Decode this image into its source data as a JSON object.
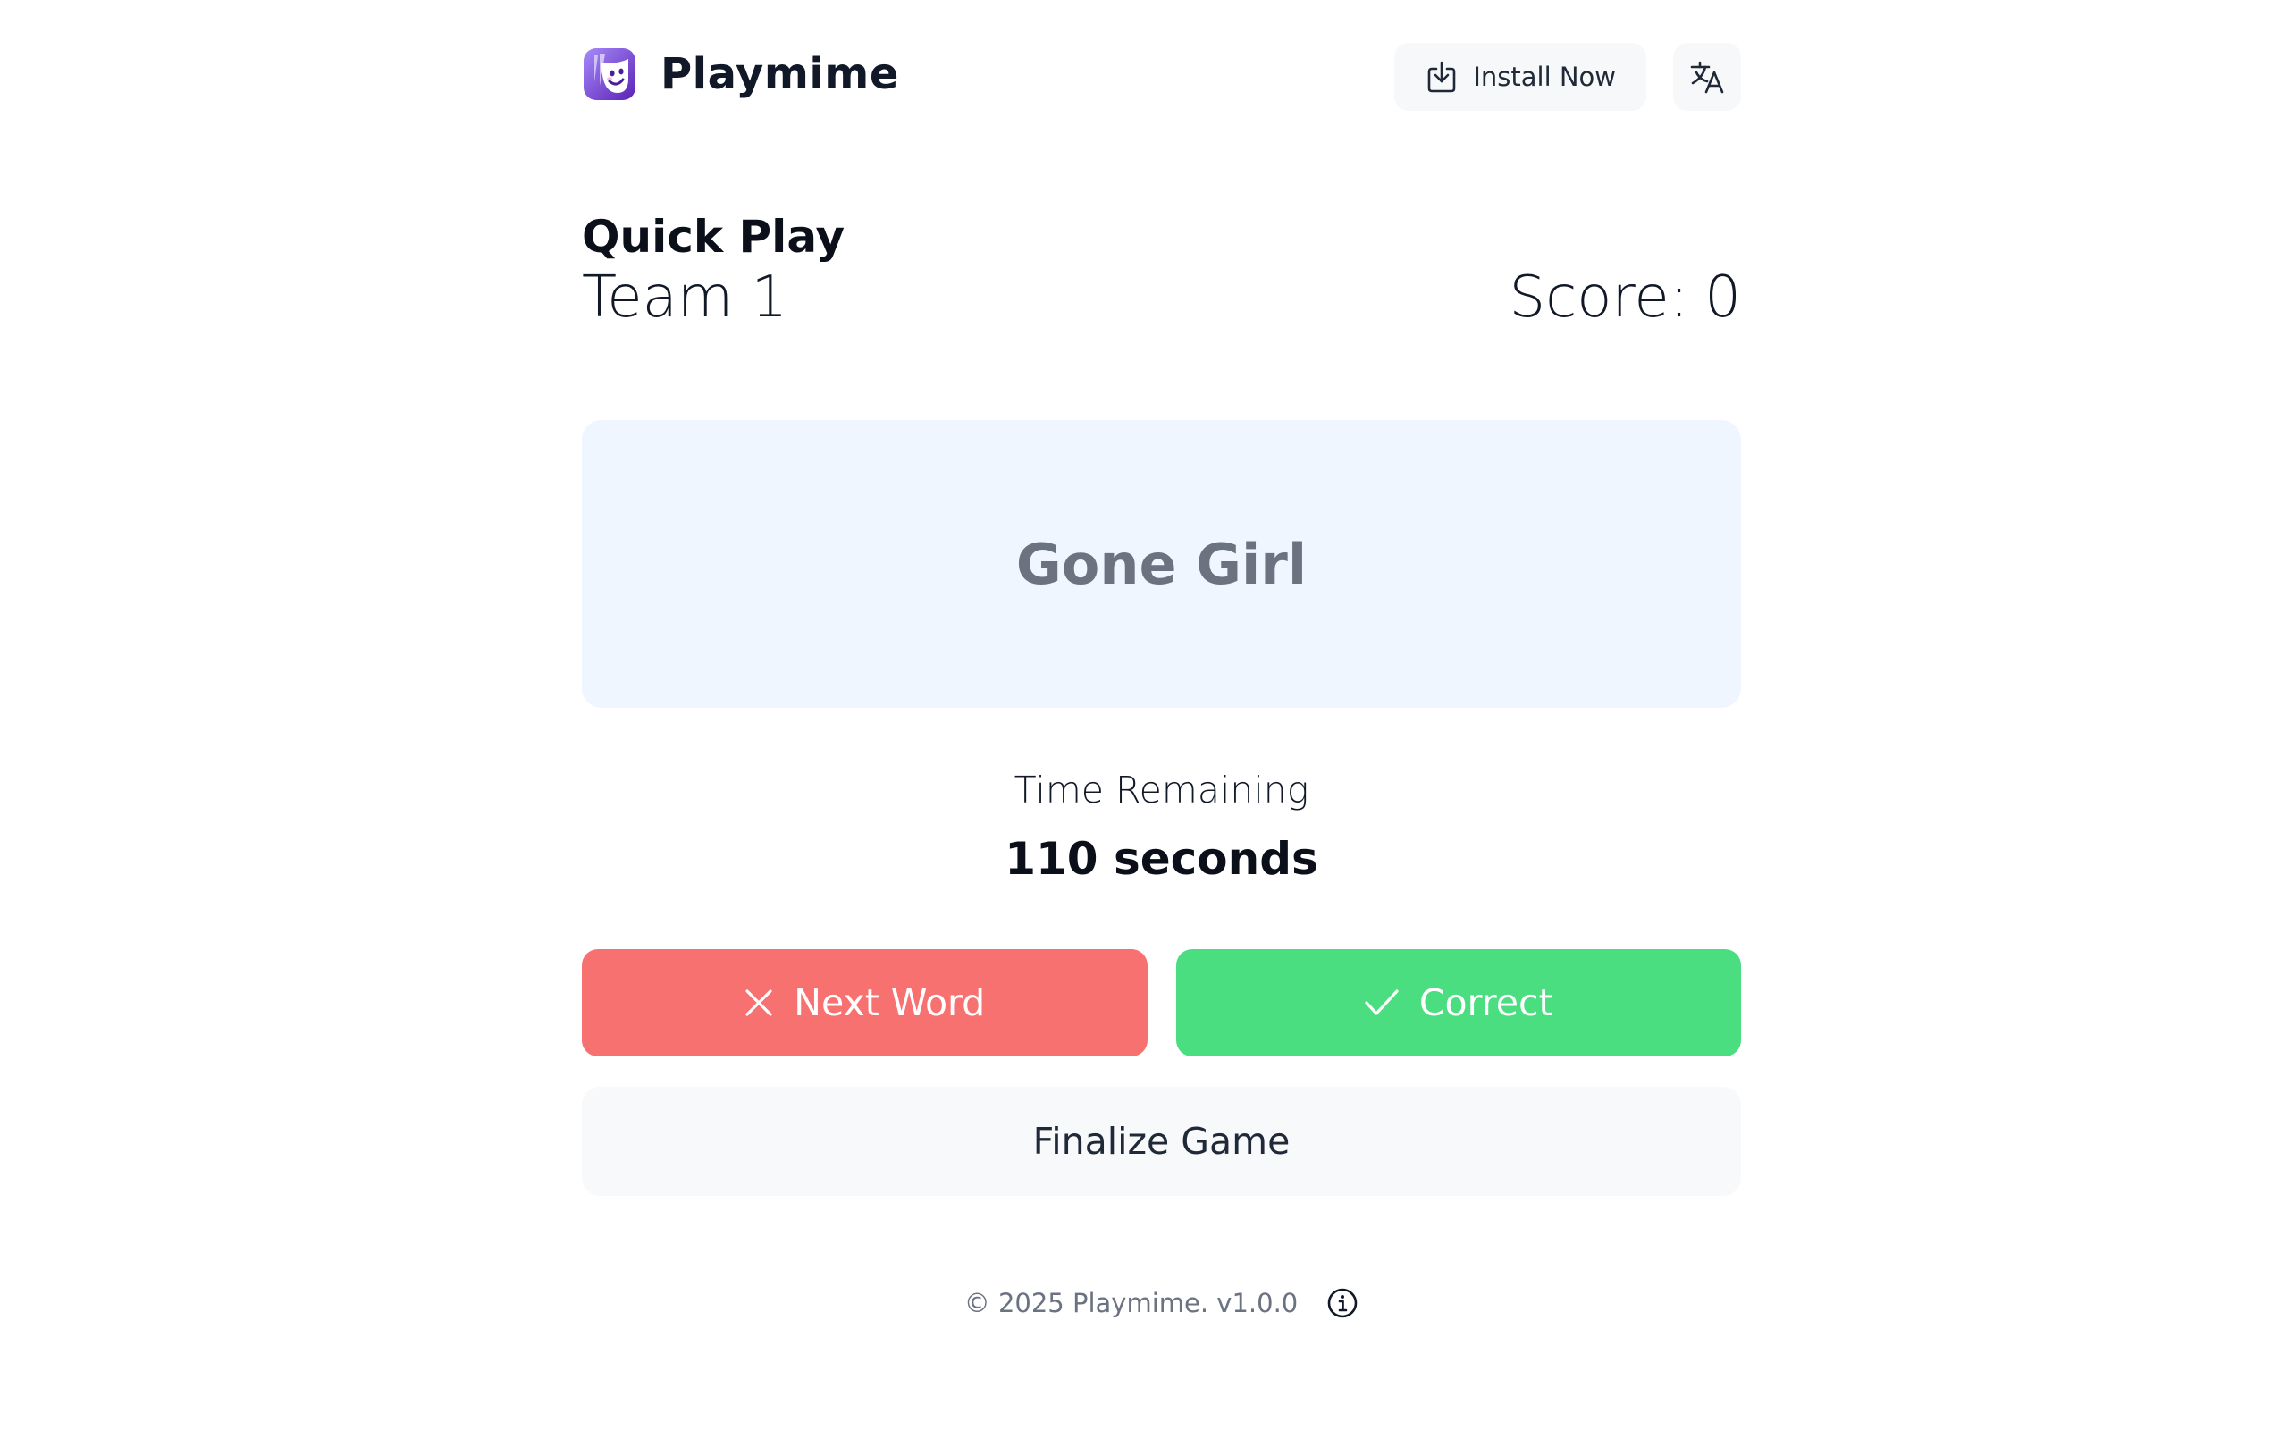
{
  "header": {
    "app_name": "Playmime",
    "install_label": "Install Now"
  },
  "game": {
    "mode": "Quick Play",
    "team": "Team 1",
    "score_label": "Score:",
    "score_value": "0",
    "current_word": "Gone Girl",
    "timer_label": "Time Remaining",
    "timer_value": "110 seconds"
  },
  "actions": {
    "next_label": "Next Word",
    "correct_label": "Correct",
    "finalize_label": "Finalize Game"
  },
  "footer": {
    "text": "© 2025 Playmime. v1.0.0"
  },
  "icons": {
    "install": "download-icon",
    "language": "translate-icon",
    "next": "close-icon",
    "correct": "check-icon",
    "info": "info-icon"
  },
  "colors": {
    "next_button": "#f87171",
    "correct_button": "#4ade80",
    "word_card": "#eff6ff",
    "logo_purple": "#7c3aed"
  }
}
